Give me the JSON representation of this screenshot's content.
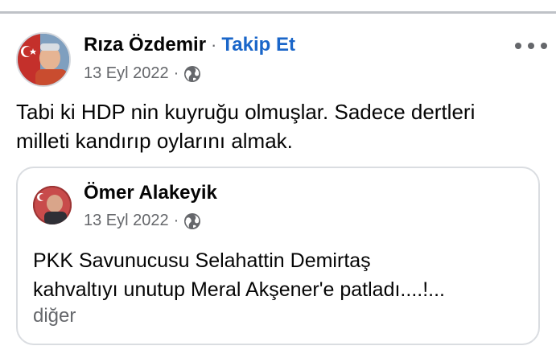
{
  "post": {
    "author": "Rıza Özdemir",
    "separator": "·",
    "follow_label": "Takip Et",
    "date": "13 Eyl 2022",
    "meta_separator": "·",
    "privacy_icon": "globe-icon",
    "more_icon": "more-options-icon",
    "text_line1": "Tabi ki HDP nin kuyruğu olmuşlar. Sadece dertleri",
    "text_line2": "milleti kandırıp oylarını almak."
  },
  "shared_post": {
    "author": "Ömer Alakeyik",
    "date": "13 Eyl 2022",
    "meta_separator": "·",
    "privacy_icon": "globe-icon",
    "text_line1": "PKK Savunucusu Selahattin Demirtaş",
    "text_line2": "kahvaltıyı unutup Meral Akşener'e patladı....!...",
    "see_more": "diğer"
  },
  "colors": {
    "link": "#1a66c9",
    "secondary_text": "#65676b",
    "primary_text": "#050505",
    "divider": "#bfc2c7",
    "card_border": "#dadde1"
  }
}
